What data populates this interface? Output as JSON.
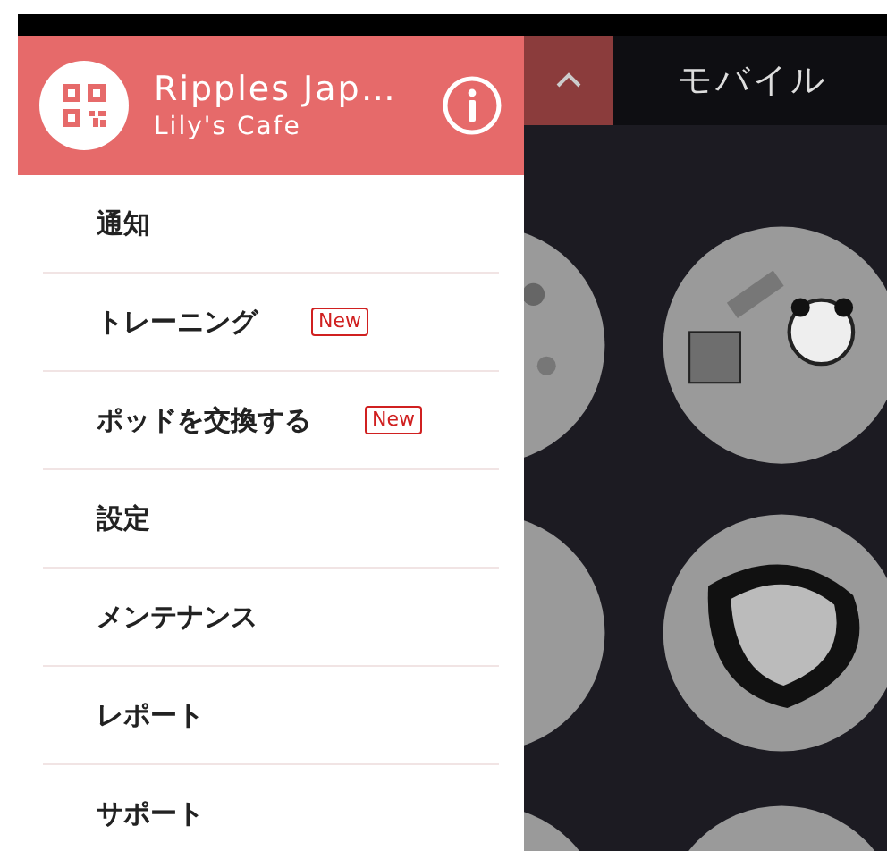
{
  "drawer": {
    "title": "Ripples Jap…",
    "subtitle": "Lily's Cafe",
    "items": [
      {
        "label": "通知"
      },
      {
        "label": "トレーニング",
        "badge": "New"
      },
      {
        "label": "ポッドを交換する",
        "badge": "New"
      },
      {
        "label": "設定"
      },
      {
        "label": "メンテナンス"
      },
      {
        "label": "レポート"
      },
      {
        "label": "サポート"
      }
    ]
  },
  "main": {
    "title": "モバイル"
  }
}
